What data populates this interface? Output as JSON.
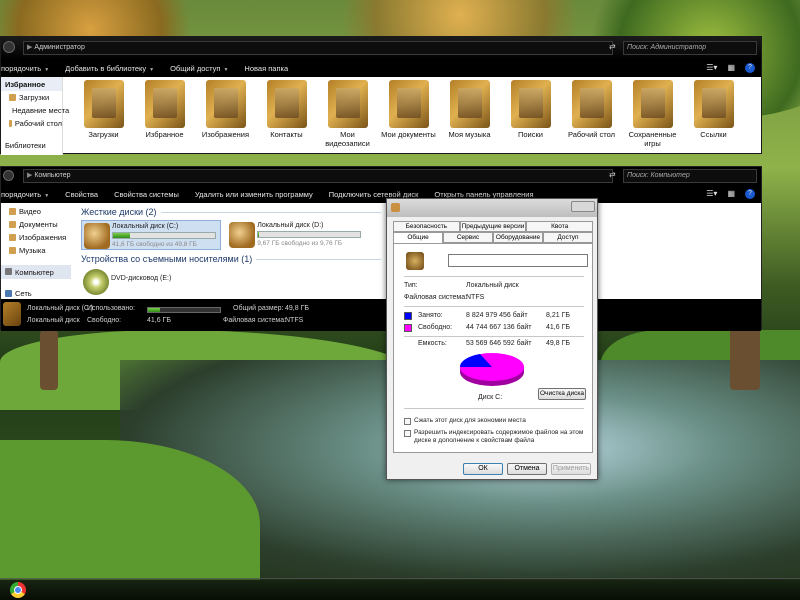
{
  "window1": {
    "address": "Администратор",
    "search_placeholder": "Поиск: Администратор",
    "toolbar": [
      {
        "label": "порядочить",
        "has_arrow": true
      },
      {
        "label": "Добавить в библиотеку",
        "has_arrow": true
      },
      {
        "label": "Общий доступ",
        "has_arrow": true
      },
      {
        "label": "Новая папка",
        "has_arrow": false
      }
    ],
    "nav": {
      "favorites_header": "Избранное",
      "favorites": [
        "Загрузки",
        "Недавние места",
        "Рабочий стол"
      ],
      "libraries_header": "Библиотеки"
    },
    "folders": [
      "Загрузки",
      "Избранное",
      "Изображения",
      "Контакты",
      "Мои видеозаписи",
      "Мои документы",
      "Моя музыка",
      "Поиски",
      "Рабочий стол",
      "Сохраненные игры",
      "Ссылки"
    ]
  },
  "window2": {
    "address": "Компьютер",
    "search_placeholder": "Поиск: Компьютер",
    "toolbar": [
      {
        "label": "порядочить",
        "has_arrow": true
      },
      {
        "label": "Свойства",
        "has_arrow": false
      },
      {
        "label": "Свойства системы",
        "has_arrow": false
      },
      {
        "label": "Удалить или изменить программу",
        "has_arrow": false
      },
      {
        "label": "Подключить сетевой диск",
        "has_arrow": false
      },
      {
        "label": "Открыть панель управления",
        "has_arrow": false
      }
    ],
    "nav": {
      "libraries": [
        "Видео",
        "Документы",
        "Изображения",
        "Музыка"
      ],
      "computer_header": "Компьютер",
      "network": "Сеть"
    },
    "hdd_header": "Жесткие диски (2)",
    "drives": [
      {
        "name": "Локальный диск (C:)",
        "free_text": "41,6 ГБ свободно из 49,8 ГБ",
        "used_fraction": 0.165
      },
      {
        "name": "Локальный диск (D:)",
        "free_text": "9,67 ГБ свободно из 9,76 ГБ",
        "used_fraction": 0.01
      }
    ],
    "removable_header": "Устройства со съемными носителями (1)",
    "dvd": {
      "name": "DVD-дисковод (E:)"
    },
    "status": {
      "name": "Локальный диск (C:)",
      "type": "Локальный диск",
      "used_label": "Использовано:",
      "used_fraction": 0.165,
      "free_label": "Свободно:",
      "free_value": "41,6 ГБ",
      "total_label": "Общий размер:",
      "total_value": "49,8 ГБ",
      "fs_label": "Файловая система:",
      "fs_value": "NTFS"
    }
  },
  "dialog": {
    "tabs_row1": [
      "Безопасность",
      "Предыдущие версии",
      "Квота"
    ],
    "tabs_row2": [
      "Общие",
      "Сервис",
      "Оборудование",
      "Доступ"
    ],
    "name_value": "",
    "type_label": "Тип:",
    "type_value": "Локальный диск",
    "fs_label": "Файловая система:",
    "fs_value": "NTFS",
    "used_label": "Занято:",
    "used_bytes": "8 824 979 456 байт",
    "used_gb": "8,21 ГБ",
    "used_color": "#0000ff",
    "free_label": "Свободно:",
    "free_bytes": "44 744 667 136 байт",
    "free_gb": "41,6 ГБ",
    "free_color": "#ff00ff",
    "capacity_label": "Емкость:",
    "capacity_bytes": "53 569 646 592 байт",
    "capacity_gb": "49,8 ГБ",
    "disk_label": "Диск C:",
    "cleanup_button": "Очистка диска",
    "compress_label": "Сжать этот диск для экономии места",
    "index_label_1": "Разрешить индексировать содержимое файлов на этом",
    "index_label_2": "диске в дополнение к свойствам файла",
    "ok": "ОК",
    "cancel": "Отмена",
    "apply": "Применить"
  }
}
